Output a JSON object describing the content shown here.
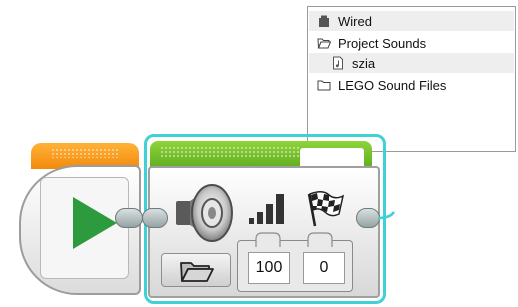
{
  "file_browser": {
    "items": [
      {
        "label": "Wired",
        "icon": "brick-icon",
        "selected": true
      },
      {
        "label": "Project Sounds",
        "icon": "open-folder-icon",
        "selected": false
      },
      {
        "label": "szia",
        "icon": "sound-file-icon",
        "selected": true
      },
      {
        "label": "LEGO Sound Files",
        "icon": "folder-icon",
        "selected": false
      }
    ]
  },
  "start_block": {
    "accent_color": "#f59a1c",
    "play_color": "#2e9a3e"
  },
  "sound_block": {
    "accent_color": "#6fbb2a",
    "selection_color": "#3fd1d6",
    "volume_value": "100",
    "play_type_value": "0",
    "icons": [
      "speaker-icon",
      "volume-bars-icon",
      "checkered-flag-icon",
      "folder-icon"
    ]
  }
}
